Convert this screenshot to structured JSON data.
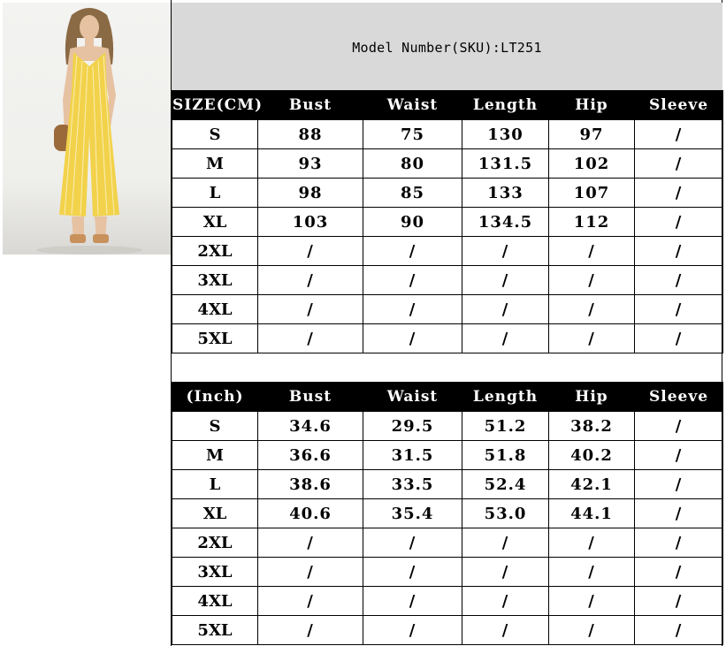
{
  "title": "Model Number(SKU):LT251",
  "colors": {
    "header_bg": "#000000",
    "title_bg": "#d9d9d9",
    "dress": "#f2d24a"
  },
  "table_cm": {
    "headers": [
      "SIZE(CM)",
      "Bust",
      "Waist",
      "Length",
      "Hip",
      "Sleeve"
    ],
    "rows": [
      [
        "S",
        "88",
        "75",
        "130",
        "97",
        "/"
      ],
      [
        "M",
        "93",
        "80",
        "131.5",
        "102",
        "/"
      ],
      [
        "L",
        "98",
        "85",
        "133",
        "107",
        "/"
      ],
      [
        "XL",
        "103",
        "90",
        "134.5",
        "112",
        "/"
      ],
      [
        "2XL",
        "/",
        "/",
        "/",
        "/",
        "/"
      ],
      [
        "3XL",
        "/",
        "/",
        "/",
        "/",
        "/"
      ],
      [
        "4XL",
        "/",
        "/",
        "/",
        "/",
        "/"
      ],
      [
        "5XL",
        "/",
        "/",
        "/",
        "/",
        "/"
      ]
    ]
  },
  "table_inch": {
    "headers": [
      "(Inch)",
      "Bust",
      "Waist",
      "Length",
      "Hip",
      "Sleeve"
    ],
    "rows": [
      [
        "S",
        "34.6",
        "29.5",
        "51.2",
        "38.2",
        "/"
      ],
      [
        "M",
        "36.6",
        "31.5",
        "51.8",
        "40.2",
        "/"
      ],
      [
        "L",
        "38.6",
        "33.5",
        "52.4",
        "42.1",
        "/"
      ],
      [
        "XL",
        "40.6",
        "35.4",
        "53.0",
        "44.1",
        "/"
      ],
      [
        "2XL",
        "/",
        "/",
        "/",
        "/",
        "/"
      ],
      [
        "3XL",
        "/",
        "/",
        "/",
        "/",
        "/"
      ],
      [
        "4XL",
        "/",
        "/",
        "/",
        "/",
        "/"
      ],
      [
        "5XL",
        "/",
        "/",
        "/",
        "/",
        "/"
      ]
    ]
  }
}
